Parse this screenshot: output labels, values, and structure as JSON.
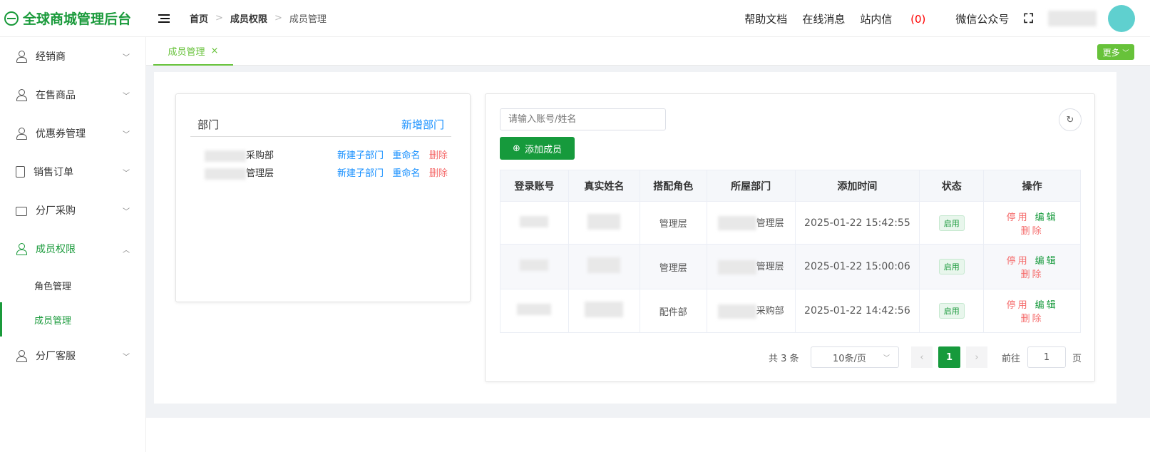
{
  "app": {
    "title": "全球商城管理后台"
  },
  "breadcrumb": [
    "首页",
    "成员权限",
    "成员管理"
  ],
  "header": {
    "help": "帮助文档",
    "online": "在线消息",
    "inbox": "站内信",
    "inbox_count": "(0)",
    "wechat": "微信公众号"
  },
  "sidebar": {
    "items": [
      {
        "label": "经销商"
      },
      {
        "label": "在售商品"
      },
      {
        "label": "优惠券管理"
      },
      {
        "label": "销售订单"
      },
      {
        "label": "分厂采购"
      },
      {
        "label": "成员权限"
      },
      {
        "label": "分厂客服"
      }
    ],
    "sub": [
      "角色管理",
      "成员管理"
    ]
  },
  "tabs": {
    "active": "成员管理",
    "close": "×",
    "more": "更多"
  },
  "dept": {
    "title": "部门",
    "add": "新增部门",
    "rows": [
      {
        "name": "采购部"
      },
      {
        "name": "管理层"
      }
    ],
    "actions": {
      "add_child": "新建子部门",
      "rename": "重命名",
      "delete": "删除"
    }
  },
  "members": {
    "search_placeholder": "请输入账号/姓名",
    "add": "添加成员",
    "columns": [
      "登录账号",
      "真实姓名",
      "搭配角色",
      "所屋部门",
      "添加时间",
      "状态",
      "操作"
    ],
    "rows": [
      {
        "role": "管理层",
        "dept": "管理层",
        "time": "2025-01-22 15:42:55",
        "status": "启用"
      },
      {
        "role": "管理层",
        "dept": "管理层",
        "time": "2025-01-22 15:00:06",
        "status": "启用"
      },
      {
        "role": "配件部",
        "dept": "采购部",
        "time": "2025-01-22 14:42:56",
        "status": "启用"
      }
    ],
    "ops": {
      "disable": "停用",
      "edit": "编辑",
      "delete": "删除"
    }
  },
  "pagination": {
    "total": "共 3 条",
    "page_size": "10条/页",
    "current": "1",
    "goto_label": "前往",
    "goto_value": "1",
    "page_suffix": "页"
  }
}
